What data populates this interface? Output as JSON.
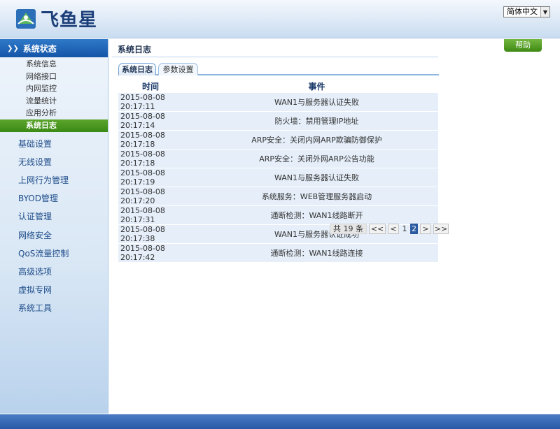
{
  "header": {
    "logo_text": "飞鱼星",
    "language": "简体中文"
  },
  "sidebar": {
    "section": "系统状态",
    "sub_items": [
      {
        "label": "系统信息",
        "active": false
      },
      {
        "label": "网络接口",
        "active": false
      },
      {
        "label": "内网监控",
        "active": false
      },
      {
        "label": "流量统计",
        "active": false
      },
      {
        "label": "应用分析",
        "active": false
      },
      {
        "label": "系统日志",
        "active": true
      }
    ],
    "items": [
      "基础设置",
      "无线设置",
      "上网行为管理",
      "BYOD管理",
      "认证管理",
      "网络安全",
      "QoS流量控制",
      "高级选项",
      "虚拟专网",
      "系统工具"
    ]
  },
  "main": {
    "title": "系统日志",
    "help_label": "帮助",
    "tabs": [
      {
        "label": "系统日志",
        "active": true
      },
      {
        "label": "参数设置",
        "active": false
      }
    ],
    "table": {
      "headers": [
        "时间",
        "事件"
      ],
      "rows": [
        {
          "time": "2015-08-08 20:17:11",
          "event": "WAN1与服务器认证失败"
        },
        {
          "time": "2015-08-08 20:17:14",
          "event": "防火墙：禁用管理IP地址"
        },
        {
          "time": "2015-08-08 20:17:18",
          "event": "ARP安全：关闭内网ARP欺骗防御保护"
        },
        {
          "time": "2015-08-08 20:17:18",
          "event": "ARP安全：关闭外网ARP公告功能"
        },
        {
          "time": "2015-08-08 20:17:19",
          "event": "WAN1与服务器认证失败"
        },
        {
          "time": "2015-08-08 20:17:20",
          "event": "系统服务：WEB管理服务器启动"
        },
        {
          "time": "2015-08-08 20:17:31",
          "event": "通断检测：WAN1线路断开"
        },
        {
          "time": "2015-08-08 20:17:38",
          "event": "WAN1与服务器认证成功"
        },
        {
          "time": "2015-08-08 20:17:42",
          "event": "通断检测：WAN1线路连接"
        }
      ]
    },
    "pager": {
      "total": "共 19 条",
      "first": "<<",
      "prev": "<",
      "pages": [
        "1",
        "2"
      ],
      "current": "2",
      "next": ">",
      "last": ">>"
    }
  },
  "colors": {
    "accent": "#1455a8",
    "active_green": "#3a8a14",
    "row_bg": "#e5eef9"
  }
}
